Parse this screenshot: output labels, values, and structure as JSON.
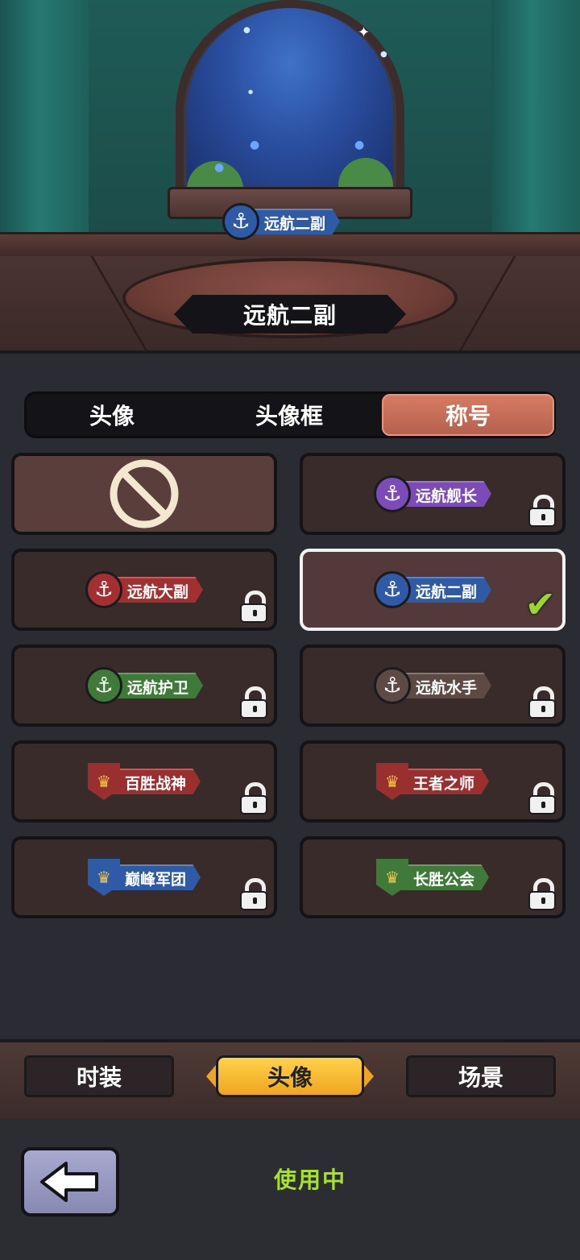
{
  "preview": {
    "badge_label": "远航二副",
    "equipped_title": "远航二副"
  },
  "tabs": [
    {
      "label": "头像",
      "active": false
    },
    {
      "label": "头像框",
      "active": false
    },
    {
      "label": "称号",
      "active": true
    }
  ],
  "titles": [
    {
      "label": "",
      "kind": "none",
      "locked": false,
      "selected": false,
      "icon": "prohibited-icon"
    },
    {
      "label": "远航舰长",
      "kind": "anchor",
      "color": "#7b4cb8",
      "locked": true,
      "selected": false,
      "icon": "anchor-icon"
    },
    {
      "label": "远航大副",
      "kind": "anchor",
      "color": "#a23030",
      "locked": true,
      "selected": false,
      "icon": "anchor-icon"
    },
    {
      "label": "远航二副",
      "kind": "anchor",
      "color": "#2f5aa6",
      "locked": false,
      "selected": true,
      "icon": "anchor-icon"
    },
    {
      "label": "远航护卫",
      "kind": "anchor",
      "color": "#3f7a3a",
      "locked": true,
      "selected": false,
      "icon": "anchor-icon"
    },
    {
      "label": "远航水手",
      "kind": "anchor",
      "color": "#5e4a44",
      "locked": true,
      "selected": false,
      "icon": "anchor-icon"
    },
    {
      "label": "百胜战神",
      "kind": "crown",
      "color": "#9a2f2f",
      "locked": true,
      "selected": false,
      "icon": "crown-shield-icon"
    },
    {
      "label": "王者之师",
      "kind": "crown",
      "color": "#9a2f2f",
      "locked": true,
      "selected": false,
      "icon": "crown-shield-icon"
    },
    {
      "label": "巅峰军团",
      "kind": "crown",
      "color": "#2f5aa6",
      "locked": true,
      "selected": false,
      "icon": "crown-shield-icon"
    },
    {
      "label": "长胜公会",
      "kind": "crown",
      "color": "#3f7a3a",
      "locked": true,
      "selected": false,
      "icon": "crown-shield-icon"
    }
  ],
  "bottom_nav": [
    {
      "label": "时装",
      "active": false
    },
    {
      "label": "头像",
      "active": true
    },
    {
      "label": "场景",
      "active": false
    }
  ],
  "footer": {
    "back_icon": "arrow-left-icon",
    "status": "使用中"
  },
  "colors": {
    "accent_tab": "#c76b56",
    "accent_nav": "#f7c234",
    "status": "#a8e22c",
    "check": "#9bd62a"
  }
}
